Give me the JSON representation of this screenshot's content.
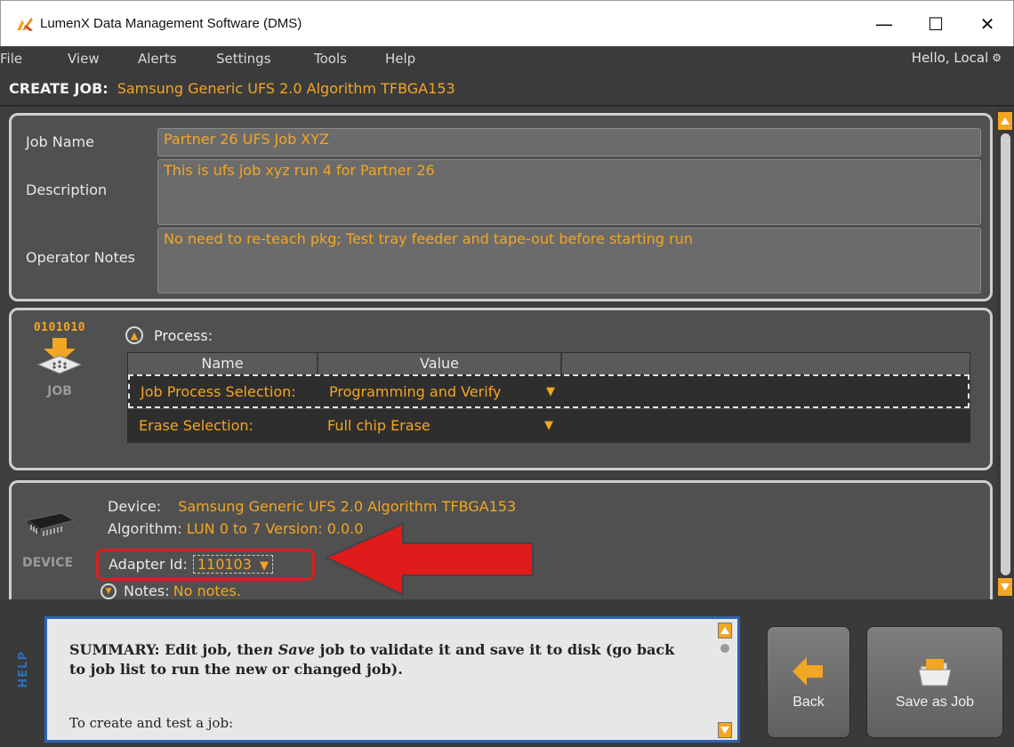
{
  "window": {
    "title": "LumenX Data Management Software (DMS)",
    "minimize": "—",
    "maximize": "☐",
    "close": "✕"
  },
  "menu": {
    "items": [
      "File",
      "View",
      "Alerts",
      "Settings",
      "Tools",
      "Help"
    ],
    "greeting": "Hello, Local"
  },
  "header": {
    "label": "CREATE JOB:",
    "value": "Samsung Generic UFS 2.0 Algorithm TFBGA153"
  },
  "job": {
    "name_label": "Job Name",
    "name_value": "Partner 26 UFS Job XYZ",
    "desc_label": "Description",
    "desc_value": "This is ufs job xyz run 4 for Partner 26",
    "notes_label": "Operator Notes",
    "notes_value": "No need to re-teach pkg; Test tray feeder and tape-out before starting run"
  },
  "process": {
    "icon_bits": "0101010",
    "icon_caption": "JOB",
    "title": "Process:",
    "col_name": "Name",
    "col_value": "Value",
    "rows": [
      {
        "name": "Job Process Selection:",
        "value": "Programming and Verify"
      },
      {
        "name": "Erase Selection:",
        "value": "Full chip Erase"
      }
    ],
    "dropdown_glyph": "▼"
  },
  "device": {
    "caption": "DEVICE",
    "device_label": "Device:",
    "device_value": "Samsung Generic UFS 2.0 Algorithm TFBGA153",
    "algorithm_label": "Algorithm:",
    "algorithm_value": "LUN 0 to 7 Version: 0.0.0",
    "adapter_label": "Adapter Id:",
    "adapter_value": "110103",
    "notes_label": "Notes:",
    "notes_value": "No notes."
  },
  "help": {
    "tab_label": "HELP",
    "summary_a": "SUMMARY: Edit job, the",
    "summary_b": "n Save",
    "summary_c": " job to validate it and save it to disk (go back to job list to run the new or changed job).",
    "sub": "To create and test a job:"
  },
  "actions": {
    "back": "Back",
    "save": "Save as Job"
  },
  "colors": {
    "accent": "#f3a622",
    "panel": "#505050",
    "help_border": "#2c63b5",
    "annotation_red": "#dd1d1d"
  }
}
